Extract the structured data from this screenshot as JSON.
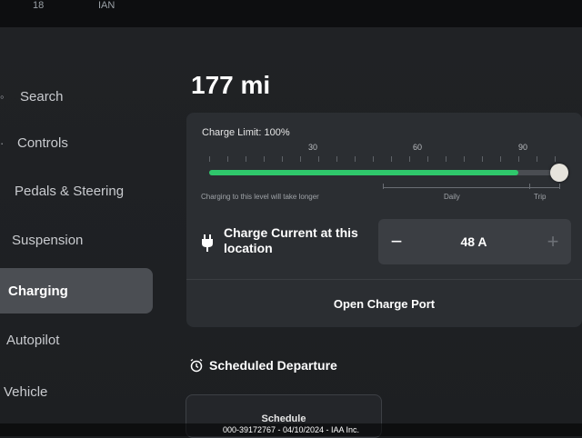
{
  "status_bar": {
    "fragments": [
      "18",
      "IAN"
    ]
  },
  "sidebar": {
    "items": [
      {
        "label": "Search",
        "icon": "search-icon",
        "active": false
      },
      {
        "label": "Controls",
        "icon": "toggle-icon",
        "active": false
      },
      {
        "label": "Pedals & Steering",
        "icon": "",
        "active": false
      },
      {
        "label": "Suspension",
        "icon": "",
        "active": false
      },
      {
        "label": "Charging",
        "icon": "",
        "active": true
      },
      {
        "label": "Autopilot",
        "icon": "",
        "active": false
      },
      {
        "label": "Vehicle",
        "icon": "",
        "active": false
      }
    ]
  },
  "main": {
    "range": "177 mi",
    "charge_limit": {
      "label": "Charge Limit: 100%",
      "value_percent": 100,
      "ticks": [
        "30",
        "60",
        "90"
      ],
      "warning": "Charging to this level will take longer",
      "zones": [
        "Daily",
        "Trip"
      ],
      "accent_color": "#2fc76b"
    },
    "charge_current": {
      "label": "Charge Current at this location",
      "value": "48 A",
      "decrement_symbol": "−",
      "increment_symbol": "+"
    },
    "open_charge_port_label": "Open Charge Port",
    "scheduled_departure": {
      "title": "Scheduled Departure",
      "button_label": "Schedule"
    }
  },
  "watermark": "000-39172767 - 04/10/2024 - IAA Inc."
}
